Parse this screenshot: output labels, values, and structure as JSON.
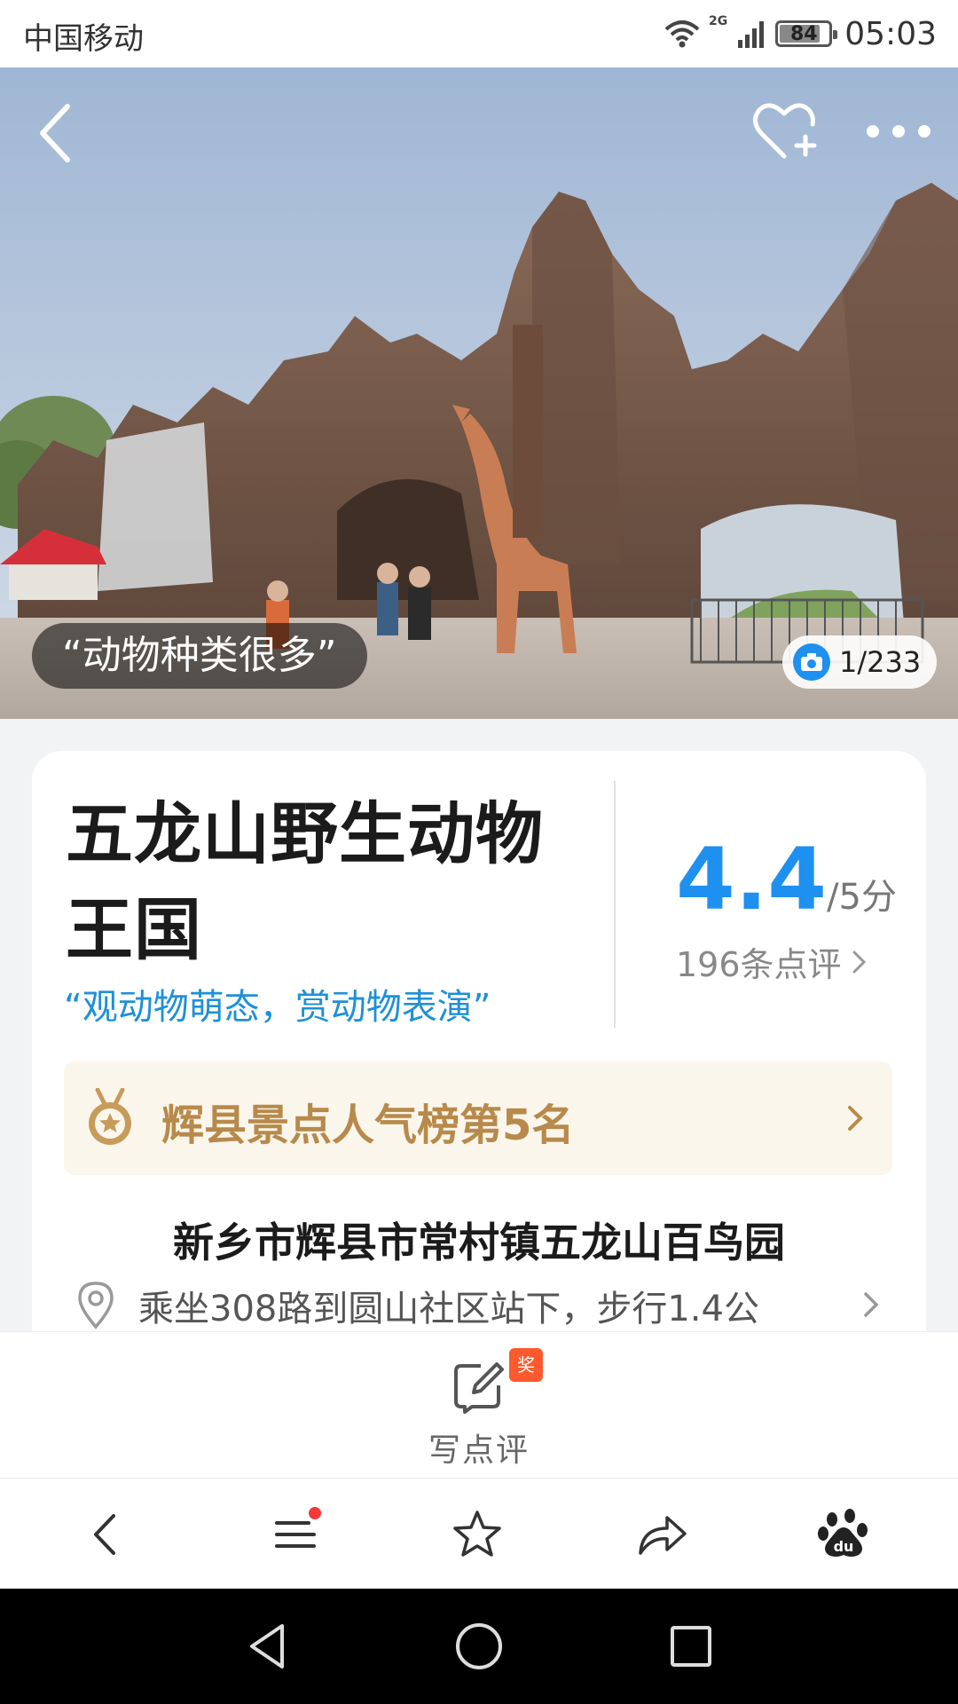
{
  "status_bar": {
    "carrier": "中国移动",
    "network": "2G",
    "battery": "84",
    "battery_level": 0.84,
    "time": "05:03"
  },
  "hero": {
    "quote": "“动物种类很多”",
    "photo_counter": "1/233",
    "icons": [
      "back-icon",
      "favorite-add-icon",
      "more-icon",
      "camera-icon"
    ]
  },
  "attraction": {
    "name": "五龙山野生动物王国",
    "slogan": "“观动物萌态，赏动物表演”",
    "score": "4.4",
    "score_max": "/5分",
    "review_count": "196条点评"
  },
  "ranking": {
    "text": "辉县景点人气榜第5名"
  },
  "address": {
    "title": "新乡市辉县市常村镇五龙山百鸟园",
    "transit": "乘坐308路到圆山社区站下，步行1.4公"
  },
  "write_review": {
    "label": "写点评",
    "badge": "奖"
  },
  "toolbar": {
    "items": [
      "back-icon",
      "menu-icon",
      "star-icon",
      "share-icon",
      "baidu-paw-icon"
    ],
    "menu_has_notification": true
  },
  "colors": {
    "accent_blue": "#1e90f0",
    "rank_gold": "#b78a4b",
    "rank_bg": "#fbf6ec",
    "badge_red": "#fc5a2e"
  }
}
